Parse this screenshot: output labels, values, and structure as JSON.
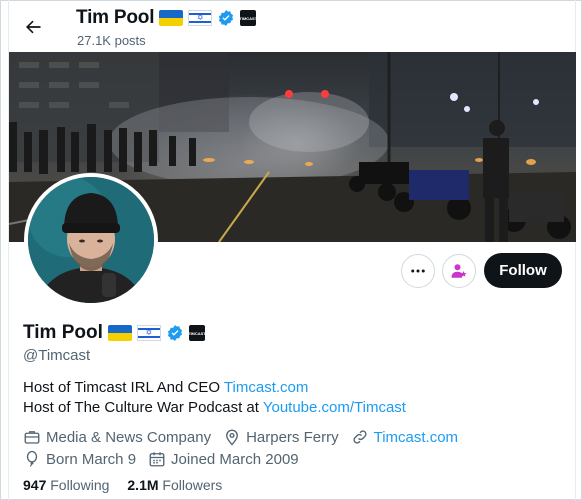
{
  "header": {
    "name": "Tim Pool",
    "posts": "27.1K posts",
    "back_icon": "arrow-left-icon"
  },
  "badges": {
    "flag1": "ukraine-flag-icon",
    "flag2": "israel-flag-icon",
    "verified": "verified-badge-icon",
    "affiliate_text": "TIMCAST"
  },
  "actions": {
    "more_icon": "more-dots-icon",
    "subscribe_icon": "subscribe-icon",
    "follow_label": "Follow"
  },
  "profile": {
    "name": "Tim Pool",
    "handle": "@Timcast",
    "bio_line1_text": "Host of Timcast IRL And CEO ",
    "bio_line1_link": "Timcast.com",
    "bio_line2_text": "Host of The Culture War Podcast at ",
    "bio_line2_link": "Youtube.com/Timcast",
    "category": "Media & News Company",
    "location": "Harpers Ferry",
    "website": "Timcast.com",
    "birthday": "Born March 9",
    "joined": "Joined March 2009",
    "following_count": "947",
    "following_label": "Following",
    "followers_count": "2.1M",
    "followers_label": "Followers"
  },
  "colors": {
    "accent": "#1d9bf0",
    "verified": "#1d9bf0",
    "subscribe": "#c936cc",
    "follow_bg": "#0f1419"
  }
}
